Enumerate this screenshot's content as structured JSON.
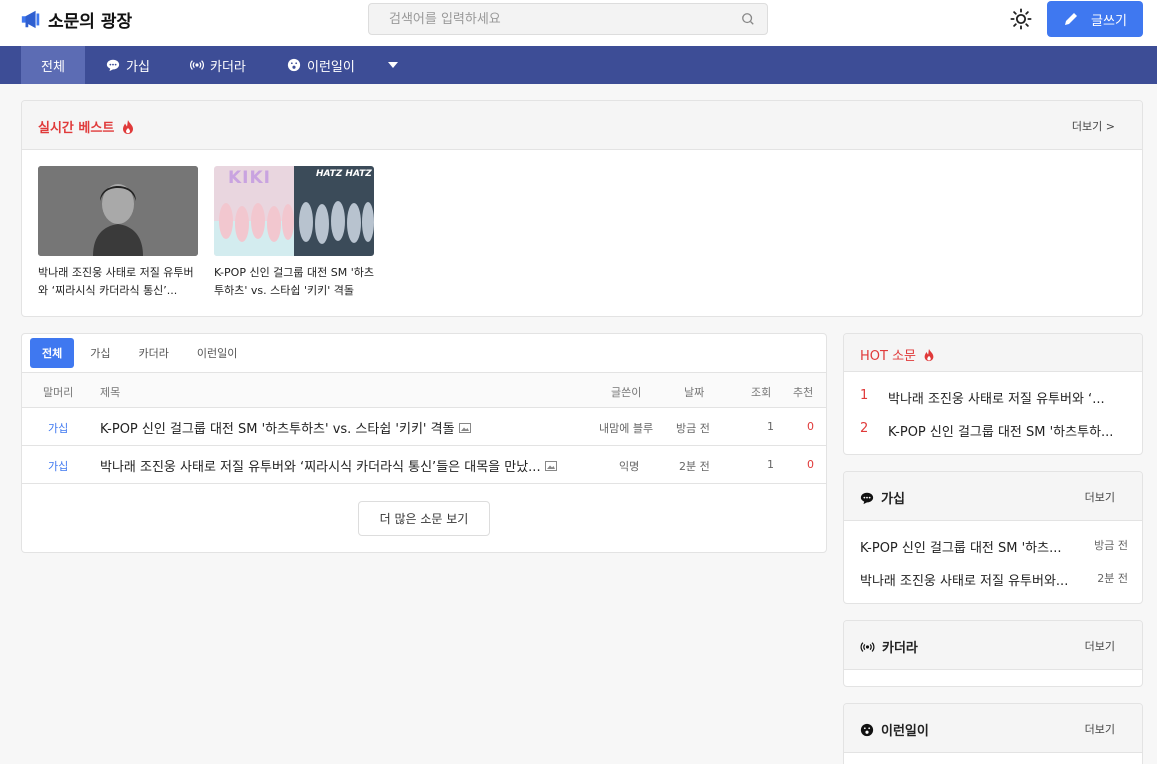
{
  "app": {
    "title": "소문의 광장"
  },
  "search": {
    "placeholder": "검색어를 입력하세요"
  },
  "header": {
    "write_label": "글쓰기"
  },
  "nav": {
    "items": [
      {
        "label": "전체"
      },
      {
        "label": "가십"
      },
      {
        "label": "카더라"
      },
      {
        "label": "이런일이"
      }
    ]
  },
  "best": {
    "title": "실시간 베스트",
    "more": "더보기 >",
    "items": [
      {
        "caption": "박나래 조진웅 사태로 저질 유투버와 ‘찌라시식 카더라식 통신’..."
      },
      {
        "caption": "K-POP 신인 걸그룹 대전 SM '하츠투하츠' vs. 스타쉽 '키키' 격돌"
      }
    ],
    "thumb_texts": {
      "kiki": "KIKI",
      "hatz": "HATZ HATZ"
    }
  },
  "board": {
    "tabs": [
      "전체",
      "가십",
      "카더라",
      "이런일이"
    ],
    "columns": {
      "category": "말머리",
      "title": "제목",
      "author": "글쓴이",
      "date": "날짜",
      "views": "조회",
      "likes": "추천"
    },
    "rows": [
      {
        "category": "가십",
        "title": "K-POP 신인 걸그룹 대전 SM '하츠투하츠' vs. 스타쉽 '키키' 격돌",
        "author": "내맘에 블루",
        "date": "방금 전",
        "views": "1",
        "likes": "0"
      },
      {
        "category": "가십",
        "title": "박나래 조진웅 사태로 저질 유투버와 ‘찌라시식 카더라식 통신’들은 대목을 만났...",
        "author": "익명",
        "date": "2분 전",
        "views": "1",
        "likes": "0"
      }
    ],
    "load_more": "더 많은 소문 보기"
  },
  "hot": {
    "title": "HOT 소문",
    "items": [
      {
        "rank": "1",
        "title": "박나래 조진웅 사태로 저질 유투버와 ‘..."
      },
      {
        "rank": "2",
        "title": "K-POP 신인 걸그룹 대전 SM '하츠투하..."
      }
    ]
  },
  "sections": {
    "gossip": {
      "title": "가십",
      "more": "더보기",
      "items": [
        {
          "title": "K-POP 신인 걸그룹 대전 SM '하츠...",
          "date": "방금 전"
        },
        {
          "title": "박나래 조진웅 사태로 저질 유투버와...",
          "date": "2분 전"
        }
      ]
    },
    "rumor": {
      "title": "카더라",
      "more": "더보기"
    },
    "wow": {
      "title": "이런일이",
      "more": "더보기"
    }
  },
  "colors": {
    "brand": "#3f78f0",
    "nav_bg": "#3d4d96",
    "nav_active": "#5c6cb4",
    "hot_red": "#e03a3a"
  },
  "icons": [
    "megaphone-icon",
    "search-icon",
    "sun-icon",
    "pencil-icon",
    "chat-icon",
    "radio-icon",
    "surprise-icon",
    "chevron-down-icon",
    "fire-icon",
    "image-icon"
  ]
}
